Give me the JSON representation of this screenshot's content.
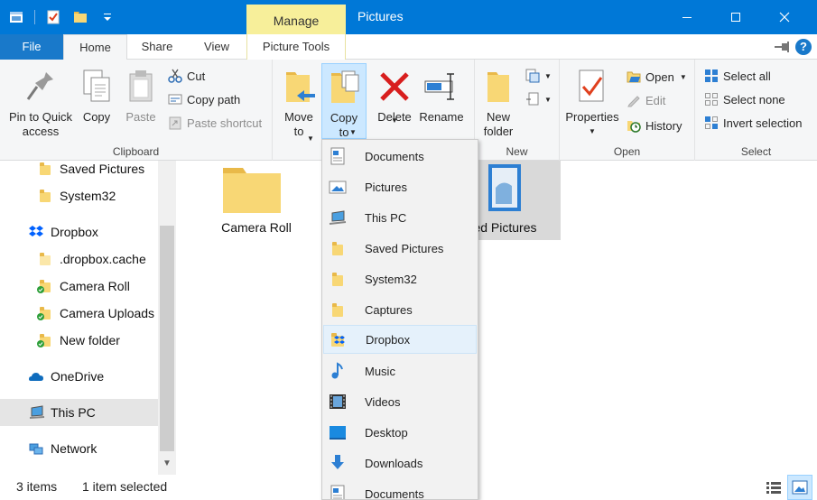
{
  "window": {
    "title": "Pictures",
    "context_tab": "Manage",
    "accent": "#0078d7",
    "controls": [
      "minimize",
      "maximize",
      "close"
    ]
  },
  "tabs": {
    "file": "File",
    "home": "Home",
    "share": "Share",
    "view": "View",
    "picture_tools": "Picture Tools",
    "help": "?"
  },
  "ribbon": {
    "clipboard": {
      "label": "Clipboard",
      "pin": "Pin to Quick\naccess",
      "copy": "Copy",
      "paste": "Paste",
      "cut": "Cut",
      "copy_path": "Copy path",
      "paste_shortcut": "Paste shortcut"
    },
    "organize": {
      "move_to": "Move\nto",
      "copy_to": "Copy\nto",
      "delete": "Delete",
      "rename": "Rename"
    },
    "new": {
      "label": "New",
      "new_folder": "New\nfolder"
    },
    "open": {
      "label": "Open",
      "properties": "Properties",
      "open": "Open",
      "edit": "Edit",
      "history": "History"
    },
    "select": {
      "label": "Select",
      "select_all": "Select all",
      "select_none": "Select none",
      "invert_selection": "Invert selection"
    }
  },
  "nav": {
    "items": [
      {
        "label": "Saved Pictures",
        "icon": "folder-icon"
      },
      {
        "label": "System32",
        "icon": "folder-icon"
      },
      {
        "label": "Dropbox",
        "icon": "dropbox-icon"
      },
      {
        "label": ".dropbox.cache",
        "icon": "folder-icon"
      },
      {
        "label": "Camera Roll",
        "icon": "folder-synced-icon"
      },
      {
        "label": "Camera Uploads",
        "icon": "camera-folder-icon"
      },
      {
        "label": "New folder",
        "icon": "folder-synced-icon"
      },
      {
        "label": "OneDrive",
        "icon": "onedrive-icon"
      },
      {
        "label": "This PC",
        "icon": "this-pc-icon"
      },
      {
        "label": "Network",
        "icon": "network-icon"
      }
    ]
  },
  "content": {
    "files": [
      {
        "label": "Camera Roll"
      },
      {
        "label": "ved Pictures"
      }
    ]
  },
  "dropdown": {
    "items": [
      {
        "label": "Documents",
        "icon": "documents-icon"
      },
      {
        "label": "Pictures",
        "icon": "pictures-icon"
      },
      {
        "label": "This PC",
        "icon": "this-pc-icon"
      },
      {
        "label": "Saved Pictures",
        "icon": "folder-icon"
      },
      {
        "label": "System32",
        "icon": "folder-icon"
      },
      {
        "label": "Captures",
        "icon": "folder-icon"
      },
      {
        "label": "Dropbox",
        "icon": "dropbox-icon"
      },
      {
        "label": "Music",
        "icon": "music-icon"
      },
      {
        "label": "Videos",
        "icon": "videos-icon"
      },
      {
        "label": "Desktop",
        "icon": "desktop-icon"
      },
      {
        "label": "Downloads",
        "icon": "downloads-icon"
      },
      {
        "label": "Documents",
        "icon": "documents-icon"
      }
    ]
  },
  "status": {
    "count": "3 items",
    "selected": "1 item selected"
  }
}
